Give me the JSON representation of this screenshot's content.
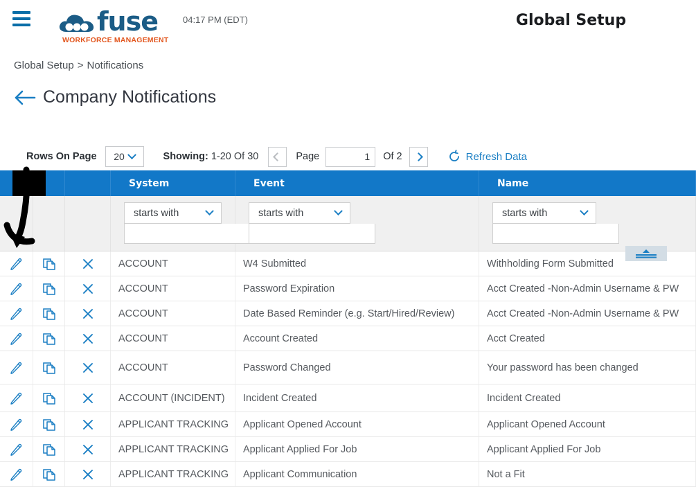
{
  "header": {
    "menu_icon": "hamburger-icon",
    "logo_word": "fuse",
    "logo_tagline": "WORKFORCE MANAGEMENT",
    "clock": "04:17 PM (EDT)",
    "app_title": "Global Setup"
  },
  "breadcrumb": {
    "root": "Global Setup",
    "separator": ">",
    "current": "Notifications"
  },
  "page": {
    "back_icon": "back-arrow-icon",
    "title": "Company Notifications"
  },
  "toolbar": {
    "rows_on_page_label": "Rows On Page",
    "rows_on_page_value": "20",
    "showing_label": "Showing:",
    "showing_value": "1-20 Of 30",
    "prev_icon": "chevron-left-icon",
    "page_label": "Page",
    "page_value": "1",
    "of_label": "Of 2",
    "next_icon": "chevron-right-icon",
    "refresh_icon": "refresh-icon",
    "refresh_label": "Refresh Data"
  },
  "grid": {
    "columns": [
      {
        "key": "edit",
        "label": ""
      },
      {
        "key": "copy",
        "label": ""
      },
      {
        "key": "delete",
        "label": ""
      },
      {
        "key": "system",
        "label": "System"
      },
      {
        "key": "event",
        "label": "Event"
      },
      {
        "key": "name",
        "label": "Name"
      }
    ],
    "filters": {
      "system": {
        "operator": "starts with",
        "value": ""
      },
      "event": {
        "operator": "starts with",
        "value": ""
      },
      "name": {
        "operator": "starts with",
        "value": ""
      }
    },
    "row_icons": {
      "edit": "pencil-icon",
      "copy": "copy-icon",
      "delete": "close-x-icon"
    },
    "collapse_icon": "collapse-up-icon",
    "rows": [
      {
        "system": "ACCOUNT",
        "event": "W4 Submitted",
        "name": "Withholding Form Submitted"
      },
      {
        "system": "ACCOUNT",
        "event": "Password Expiration",
        "name": "Acct Created -Non-Admin Username & PW"
      },
      {
        "system": "ACCOUNT",
        "event": "Date Based Reminder (e.g. Start/Hired/Review)",
        "name": "Acct Created -Non-Admin Username & PW"
      },
      {
        "system": "ACCOUNT",
        "event": "Account Created",
        "name": "Acct Created"
      },
      {
        "system": "ACCOUNT",
        "event": "Password Changed",
        "name": "Your password has been changed"
      },
      {
        "system": "ACCOUNT (INCIDENT)",
        "event": "Incident Created",
        "name": "Incident Created"
      },
      {
        "system": "APPLICANT TRACKING",
        "event": "Applicant Opened Account",
        "name": "Applicant Opened Account"
      },
      {
        "system": "APPLICANT TRACKING",
        "event": "Applicant Applied For Job",
        "name": "Applicant Applied For Job"
      },
      {
        "system": "APPLICANT TRACKING",
        "event": "Applicant Communication",
        "name": "Not a Fit"
      }
    ]
  },
  "annotation": {
    "type": "down-arrow-marker",
    "color": "#000000"
  },
  "colors": {
    "header_blue": "#1278c8",
    "link_blue": "#1b7fc4",
    "logo_blue": "#1b5c86",
    "logo_orange": "#e2571f"
  }
}
